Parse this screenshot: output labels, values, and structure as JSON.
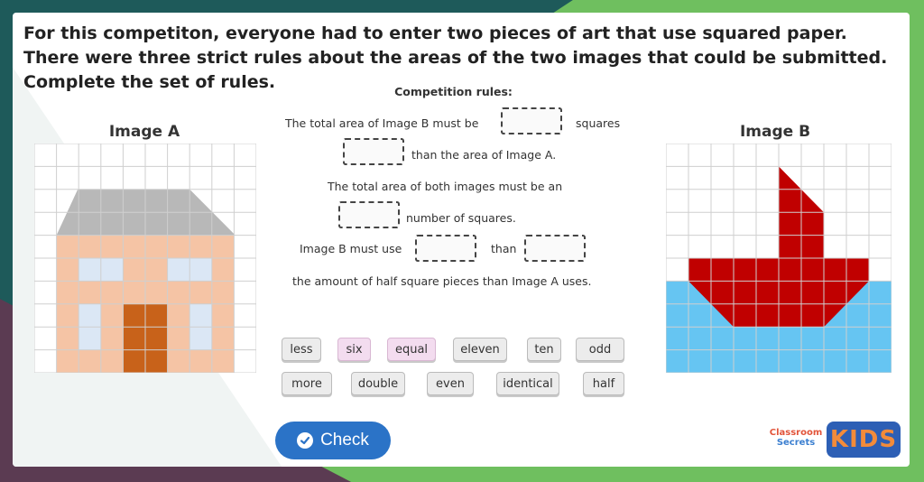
{
  "question": "For this competiton, everyone had to enter two pieces of art that use squared paper. There were three strict rules about the areas of the two images that could be submitted. Complete the set of rules.",
  "image_a": {
    "title": "Image A"
  },
  "image_b": {
    "title": "Image B"
  },
  "rules": {
    "title": "Competition rules:",
    "r1_a": "The total area of Image B must be",
    "r1_b": "squares",
    "r1_c": "than the area of Image A.",
    "r2_a": "The total area of both images must be an",
    "r2_b": "number of squares.",
    "r3_a": "Image B must use",
    "r3_b": "than",
    "r3_c": "the amount of half square pieces than Image A uses."
  },
  "word_bank": {
    "row1": [
      "less",
      "six",
      "equal",
      "eleven",
      "ten",
      "odd"
    ],
    "row2": [
      "more",
      "double",
      "even",
      "identical",
      "half"
    ]
  },
  "check_button": {
    "label": "Check"
  },
  "branding": {
    "classroom_line1": "Classroom",
    "classroom_line2": "Secrets",
    "kids": "KIDS"
  },
  "colors": {
    "roof": "#b8b8b8",
    "house": "#f5c4a5",
    "window": "#dbe7f5",
    "door": "#c8621a",
    "boat": "#c00000",
    "sea": "#66c5f2",
    "grid_line": "#cfcfcf"
  }
}
